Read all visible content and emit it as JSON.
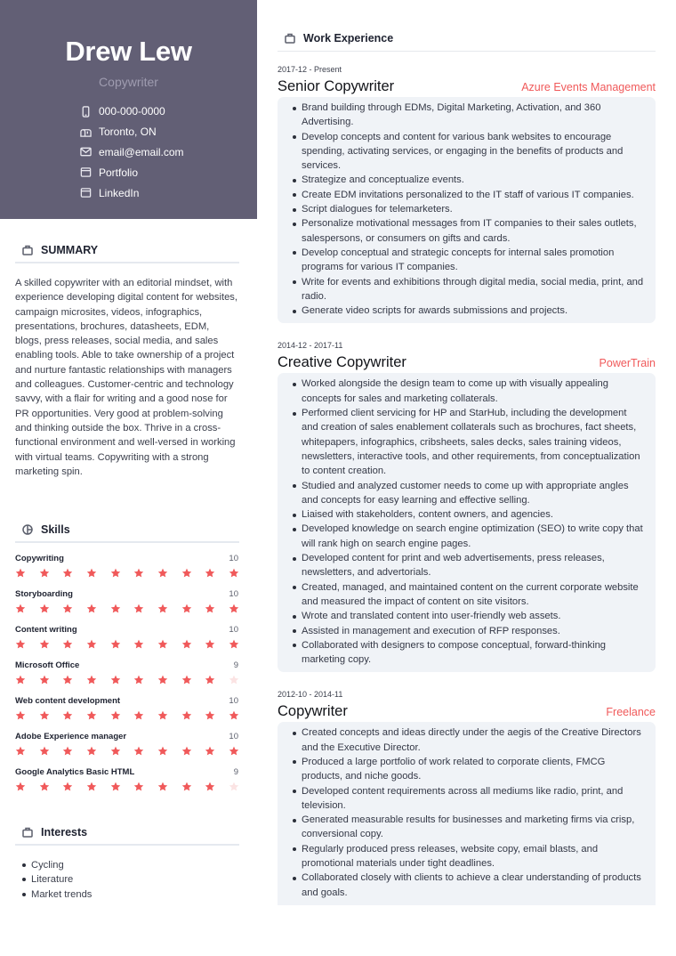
{
  "header": {
    "name": "Drew Lew",
    "role": "Copywriter",
    "background_color": "#625f75",
    "contacts": [
      {
        "icon": "phone-icon",
        "label": "000-000-0000"
      },
      {
        "icon": "mailbox-icon",
        "label": "Toronto, ON"
      },
      {
        "icon": "envelope-icon",
        "label": "email@email.com"
      },
      {
        "icon": "browser-window-icon",
        "label": "Portfolio"
      },
      {
        "icon": "browser-window-icon",
        "label": "LinkedIn"
      }
    ]
  },
  "summary": {
    "title": "SUMMARY",
    "icon": "briefcase-icon",
    "text": "A skilled copywriter with an editorial mindset, with experience developing digital content for websites, campaign microsites, videos, infographics, presentations, brochures, datasheets, EDM, blogs, press releases, social media, and sales enabling tools. Able to take ownership of a project and nurture fantastic relationships with managers and colleagues. Customer-centric and technology savvy, with a flair for writing and a good nose for PR opportunities. Very good at problem-solving and thinking outside the box. Thrive in a cross-functional environment and well-versed in working with virtual teams. Copywriting with a strong marketing spin."
  },
  "skills": {
    "title": "Skills",
    "icon": "pie-chart-icon",
    "max_level": 10,
    "star_color": "#f0595a",
    "star_empty_color": "#fbe3e3",
    "items": [
      {
        "name": "Copywriting",
        "level": 10
      },
      {
        "name": "Storyboarding",
        "level": 10
      },
      {
        "name": "Content writing",
        "level": 10
      },
      {
        "name": "Microsoft Office",
        "level": 9
      },
      {
        "name": "Web content development",
        "level": 10
      },
      {
        "name": "Adobe Experience manager",
        "level": 10
      },
      {
        "name": "Google Analytics Basic HTML",
        "level": 9
      }
    ]
  },
  "interests": {
    "title": "Interests",
    "icon": "briefcase-icon",
    "items": [
      "Cycling",
      "Literature",
      "Market trends"
    ]
  },
  "work": {
    "title": "Work Experience",
    "icon": "briefcase-icon",
    "accent_color": "#f0595a",
    "jobs": [
      {
        "date": "2017-12 - Present",
        "title": "Senior Copywriter",
        "company": "Azure Events Management",
        "bullets": [
          "Brand building through EDMs, Digital Marketing, Activation, and 360 Advertising.",
          "Develop concepts and content for various bank websites to encourage spending, activating services, or engaging in the benefits of products and services.",
          "Strategize and conceptualize events.",
          "Create EDM invitations personalized to the IT staff of various IT companies.",
          "Script dialogues for telemarketers.",
          "Personalize motivational messages from IT companies to their sales outlets, salespersons, or consumers on gifts and cards.",
          "Develop conceptual and strategic concepts for internal sales promotion programs for various IT companies.",
          "Write for events and exhibitions through digital media, social media, print, and radio.",
          "Generate video scripts for awards submissions and projects."
        ]
      },
      {
        "date": "2014-12 - 2017-11",
        "title": "Creative Copywriter",
        "company": "PowerTrain",
        "bullets": [
          "Worked alongside the design team to come up with visually appealing concepts for sales and marketing collaterals.",
          "Performed client servicing for HP and StarHub, including the development and creation of sales enablement collaterals such as brochures, fact sheets, whitepapers, infographics, cribsheets, sales decks, sales training videos, newsletters, interactive tools, and other requirements, from conceptualization to content creation.",
          "Studied and analyzed customer needs to come up with appropriate angles and concepts for easy learning and effective selling.",
          "Liaised with stakeholders, content owners, and agencies.",
          "Developed knowledge on search engine optimization (SEO) to write copy that will rank high on search engine pages.",
          "Developed content for print and web advertisements, press releases, newsletters, and advertorials.",
          "Created, managed, and maintained content on the current corporate website and measured the impact of content on site visitors.",
          "Wrote and translated content into user-friendly web assets.",
          "Assisted in management and execution of RFP responses.",
          "Collaborated with designers to compose conceptual, forward-thinking marketing copy."
        ]
      },
      {
        "date": "2012-10 - 2014-11",
        "title": "Copywriter",
        "company": "Freelance",
        "bullets": [
          "Created concepts and ideas directly under the aegis of the Creative Directors and the Executive Director.",
          "Produced a large portfolio of work related to corporate clients, FMCG products, and niche goods.",
          "Developed content requirements across all mediums like radio, print, and television.",
          "Generated measurable results for businesses and marketing firms via crisp, conversional copy.",
          "Regularly produced press releases, website copy, email blasts, and promotional materials under tight deadlines.",
          "Collaborated closely with clients to achieve a clear understanding of products and goals."
        ]
      }
    ]
  }
}
